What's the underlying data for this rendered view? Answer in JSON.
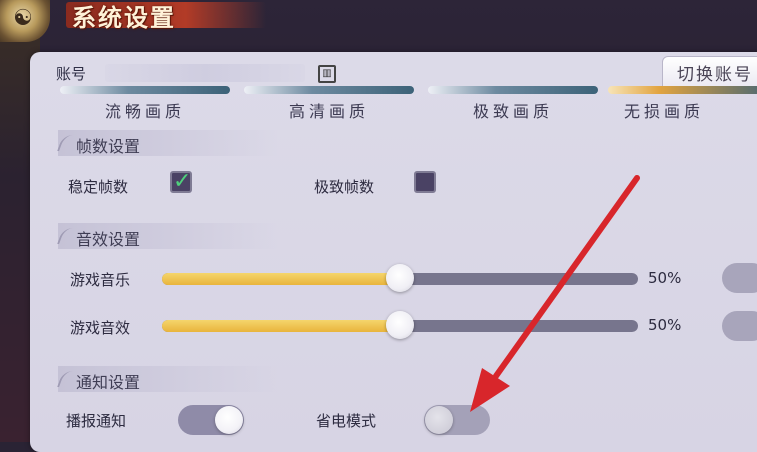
{
  "window": {
    "title": "系统设置"
  },
  "account": {
    "label": "账号",
    "switch_button": "切换账号"
  },
  "quality": {
    "options": [
      {
        "label": "流畅画质"
      },
      {
        "label": "高清画质"
      },
      {
        "label": "极致画质"
      },
      {
        "label": "无损画质"
      }
    ],
    "selected": "无损画质"
  },
  "frame": {
    "section_title": "帧数设置",
    "stable_label": "稳定帧数",
    "stable_checked": true,
    "extreme_label": "极致帧数",
    "extreme_checked": false
  },
  "audio": {
    "section_title": "音效设置",
    "music_label": "游戏音乐",
    "music_value": "50%",
    "music_level": 0.5,
    "sfx_label": "游戏音效",
    "sfx_value": "50%",
    "sfx_level": 0.5
  },
  "notify": {
    "section_title": "通知设置",
    "broadcast_label": "播报通知",
    "broadcast_on": true,
    "power_label": "省电模式",
    "power_on": false
  },
  "colors": {
    "accent_fill": "#e9b43c",
    "arrow": "#d8262b",
    "check": "#4fd07c"
  },
  "icons": {
    "logo": "taiji-icon",
    "check": "check-icon",
    "arrow": "red-arrow-annotation"
  }
}
